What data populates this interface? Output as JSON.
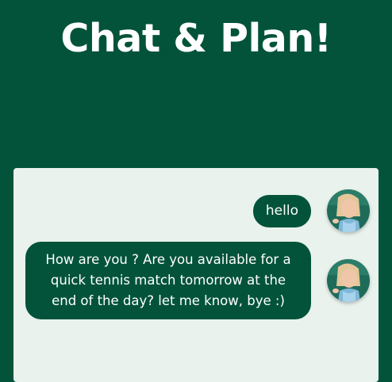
{
  "app": {
    "title": "Chat & Plan!"
  },
  "colors": {
    "brand_green": "#02533a",
    "panel_bg": "#e9f2ec",
    "bubble_text": "#ffffff"
  },
  "chat": {
    "messages": [
      {
        "text": "hello",
        "avatar": "user-avatar-photo"
      },
      {
        "text": "How are you ? Are you available for a quick tennis match tomorrow at the end of the day? let me know, bye :)",
        "avatar": "user-avatar-photo"
      }
    ]
  }
}
